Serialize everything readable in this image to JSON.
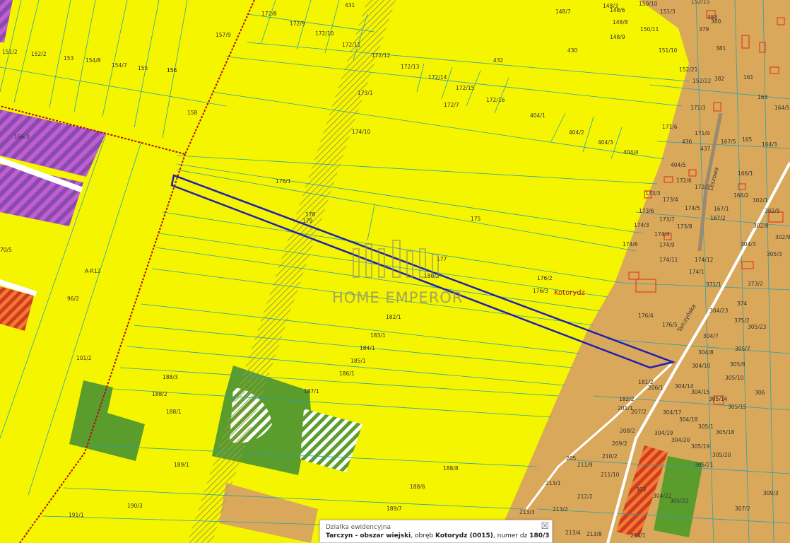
{
  "map": {
    "colors": {
      "agricultural": "#f5f500",
      "residential": "#d9a85a",
      "green": "#5a9d2d",
      "purple_zone": "#a85cc0",
      "red_zone": "#e05a28",
      "parcel_line": "#2aa0b0",
      "selected_parcel": "#2020b0",
      "boundary": "#b01010",
      "building": "#e04020"
    },
    "place_name": "Kotorydz",
    "road_labels": [
      "Tarczyńska",
      "Leszowa"
    ],
    "zone_label": "A-R12",
    "parcels": [
      "431",
      "172/8",
      "172/9",
      "172/10",
      "172/11",
      "172/12",
      "172/13",
      "172/14",
      "172/15",
      "172/16",
      "172/7",
      "148/7",
      "148/3",
      "148/6",
      "148/8",
      "148/9",
      "150/10",
      "150/11",
      "151/3",
      "151/10",
      "152/15",
      "152/21",
      "152/22",
      "430",
      "432",
      "173/1",
      "174/10",
      "404/1",
      "404/2",
      "404/3",
      "404/4",
      "171/6",
      "157/9",
      "151/2",
      "152/2",
      "153",
      "154/8",
      "154/7",
      "155",
      "156",
      "158",
      "176/1",
      "178",
      "179",
      "175",
      "177",
      "180/3",
      "176/2",
      "176/3",
      "182/1",
      "183/1",
      "184/1",
      "185/1",
      "186/1",
      "187/1",
      "188/3",
      "188/2",
      "188/1",
      "189/1",
      "188/8",
      "188/6",
      "189/7",
      "190/3",
      "191/1",
      "96/2",
      "101/2",
      "70/5",
      "166/3",
      "379",
      "380",
      "381",
      "382",
      "383",
      "156",
      "161",
      "163",
      "164/3",
      "164/5",
      "165",
      "167/5",
      "166/1",
      "166/2",
      "171/3",
      "171/9",
      "436",
      "437",
      "404/5",
      "172/6",
      "172/3",
      "173/3",
      "173/4",
      "174/5",
      "167/1",
      "167/2",
      "173/6",
      "173/7",
      "174/3",
      "174/4",
      "173/8",
      "174/6",
      "174/9",
      "174/11",
      "174/12",
      "174/1",
      "176/4",
      "176/5",
      "302/1",
      "302/5",
      "302/8",
      "302/9",
      "304/3",
      "305/3",
      "371/1",
      "373/2",
      "304/23",
      "375/2",
      "305/23",
      "374",
      "304/7",
      "304/8",
      "304/10",
      "305/7",
      "305/8",
      "305/10",
      "306",
      "304/14",
      "304/15",
      "305/14",
      "305/15",
      "304/17",
      "304/18",
      "304/19",
      "304/20",
      "305/1",
      "305/18",
      "305/19",
      "305/20",
      "305/21",
      "305/22",
      "304/22",
      "303",
      "309/3",
      "307/2",
      "181/2",
      "206/1",
      "182/2",
      "201/1",
      "207/2",
      "208/2",
      "209/2",
      "210/2",
      "211/9",
      "211/10",
      "205",
      "213/1",
      "212/2",
      "213/2",
      "213/3",
      "213/4",
      "213/8",
      "214/1"
    ]
  },
  "watermark": {
    "text": "HOME EMPEROR"
  },
  "popup": {
    "title": "Działka ewidencyjna",
    "locality": "Tarczyn - obszar wiejski",
    "sep1": ", obręb ",
    "precinct": "Kotorydz (0015)",
    "sep2": ", numer dz ",
    "parcel_number": "180/3",
    "close_label": "☒"
  }
}
